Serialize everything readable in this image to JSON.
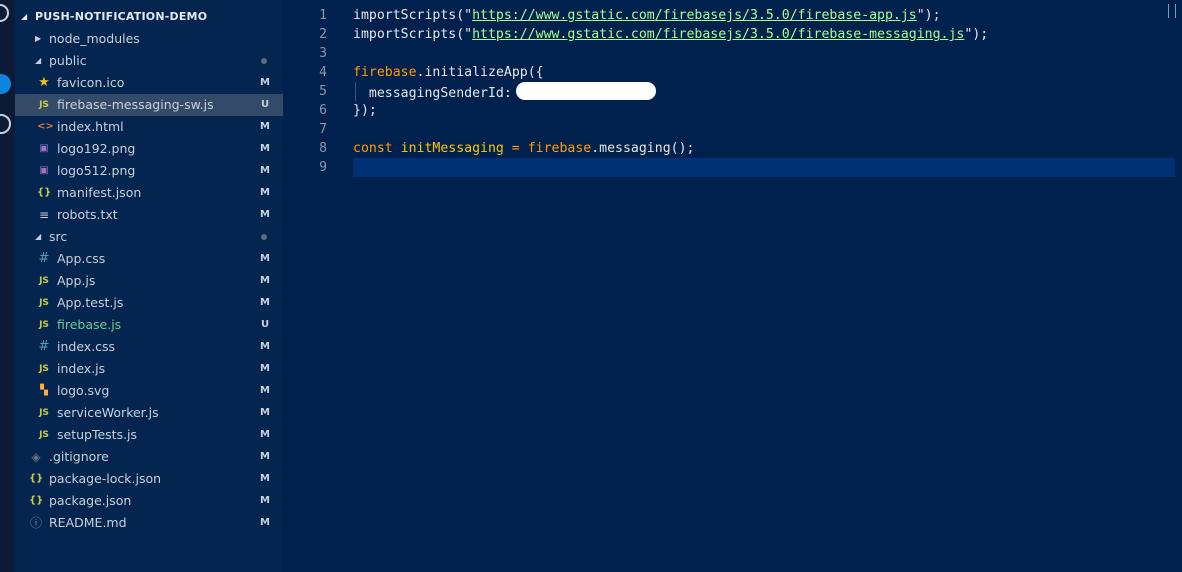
{
  "explorer": {
    "root_title": "PUSH-NOTIFICATION-DEMO",
    "items": [
      {
        "label": "node_modules",
        "type": "folder",
        "expanded": false,
        "depth": 1,
        "status": ""
      },
      {
        "label": "public",
        "type": "folder",
        "expanded": true,
        "depth": 1,
        "status": "dot"
      },
      {
        "label": "favicon.ico",
        "icon": "star-icon",
        "depth": 2,
        "status": "M"
      },
      {
        "label": "firebase-messaging-sw.js",
        "icon": "js-icon",
        "depth": 2,
        "status": "U",
        "selected": true
      },
      {
        "label": "index.html",
        "icon": "html-icon",
        "depth": 2,
        "status": "M"
      },
      {
        "label": "logo192.png",
        "icon": "image-icon",
        "depth": 2,
        "status": "M"
      },
      {
        "label": "logo512.png",
        "icon": "image-icon",
        "depth": 2,
        "status": "M"
      },
      {
        "label": "manifest.json",
        "icon": "json-icon",
        "depth": 2,
        "status": "M"
      },
      {
        "label": "robots.txt",
        "icon": "text-icon",
        "depth": 2,
        "status": "M"
      },
      {
        "label": "src",
        "type": "folder",
        "expanded": true,
        "depth": 1,
        "status": "dot"
      },
      {
        "label": "App.css",
        "icon": "css-icon",
        "depth": 2,
        "status": "M"
      },
      {
        "label": "App.js",
        "icon": "js-icon",
        "depth": 2,
        "status": "M"
      },
      {
        "label": "App.test.js",
        "icon": "js-icon",
        "depth": 2,
        "status": "M"
      },
      {
        "label": "firebase.js",
        "icon": "js-icon",
        "depth": 2,
        "status": "U"
      },
      {
        "label": "index.css",
        "icon": "css-icon",
        "depth": 2,
        "status": "M"
      },
      {
        "label": "index.js",
        "icon": "js-icon",
        "depth": 2,
        "status": "M"
      },
      {
        "label": "logo.svg",
        "icon": "svg-icon",
        "depth": 2,
        "status": "M"
      },
      {
        "label": "serviceWorker.js",
        "icon": "js-icon",
        "depth": 2,
        "status": "M"
      },
      {
        "label": "setupTests.js",
        "icon": "js-icon",
        "depth": 2,
        "status": "M"
      },
      {
        "label": ".gitignore",
        "icon": "git-icon",
        "depth": 1,
        "status": "M"
      },
      {
        "label": "package-lock.json",
        "icon": "json-icon",
        "depth": 1,
        "status": "M"
      },
      {
        "label": "package.json",
        "icon": "json-icon",
        "depth": 1,
        "status": "M"
      },
      {
        "label": "README.md",
        "icon": "info-icon",
        "depth": 1,
        "status": "M"
      }
    ],
    "icon_glyphs": {
      "js-icon": "JS",
      "css-icon": "#",
      "json-icon": "{}",
      "html-icon": "<>",
      "image-icon": "▣",
      "text-icon": "≡",
      "star-icon": "★",
      "svg-icon": "▚",
      "git-icon": "◈",
      "info-icon": "ⓘ"
    }
  },
  "editor": {
    "line_numbers": [
      "1",
      "2",
      "3",
      "4",
      "5",
      "6",
      "7",
      "8",
      "9"
    ],
    "lines": [
      [
        {
          "t": "fn",
          "v": "importScripts"
        },
        {
          "t": "punc",
          "v": "(\""
        },
        {
          "t": "url",
          "v": "https://www.gstatic.com/firebasejs/3.5.0/firebase-app.js"
        },
        {
          "t": "punc",
          "v": "\");"
        }
      ],
      [
        {
          "t": "fn",
          "v": "importScripts"
        },
        {
          "t": "punc",
          "v": "(\""
        },
        {
          "t": "url",
          "v": "https://www.gstatic.com/firebasejs/3.5.0/firebase-messaging.js"
        },
        {
          "t": "punc",
          "v": "\");"
        }
      ],
      [],
      [
        {
          "t": "obj",
          "v": "firebase"
        },
        {
          "t": "punc",
          "v": "."
        },
        {
          "t": "fn",
          "v": "initializeApp"
        },
        {
          "t": "punc",
          "v": "({"
        }
      ],
      [
        {
          "t": "prop",
          "v": "  messagingSenderId"
        },
        {
          "t": "punc",
          "v": ":"
        },
        {
          "t": "redacted",
          "v": ""
        }
      ],
      [
        {
          "t": "punc",
          "v": "});"
        }
      ],
      [],
      [
        {
          "t": "kw",
          "v": "const "
        },
        {
          "t": "var",
          "v": "initMessaging"
        },
        {
          "t": "op",
          "v": " = "
        },
        {
          "t": "obj",
          "v": "firebase"
        },
        {
          "t": "punc",
          "v": "."
        },
        {
          "t": "fn",
          "v": "messaging"
        },
        {
          "t": "punc",
          "v": "();"
        }
      ],
      []
    ],
    "current_line": 9
  },
  "colors": {
    "editor_bg": "#00214e",
    "sidebar_bg": "#04254f",
    "selected_row": "#344a69",
    "untracked": "#73c991"
  }
}
